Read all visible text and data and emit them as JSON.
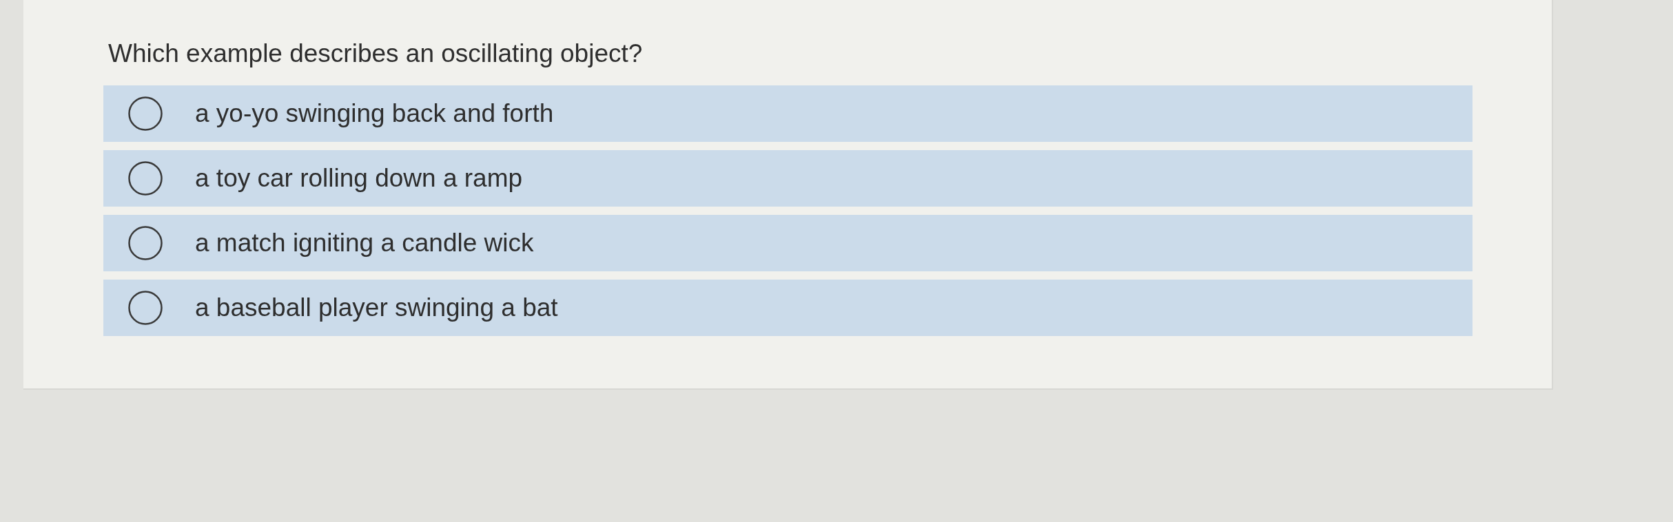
{
  "question": "Which example describes an oscillating object?",
  "options": [
    {
      "label": "a yo-yo swinging back and forth",
      "selected": false
    },
    {
      "label": "a toy car rolling down a ramp",
      "selected": false
    },
    {
      "label": "a match igniting a candle wick",
      "selected": false
    },
    {
      "label": "a baseball player swinging a bat",
      "selected": false
    }
  ]
}
